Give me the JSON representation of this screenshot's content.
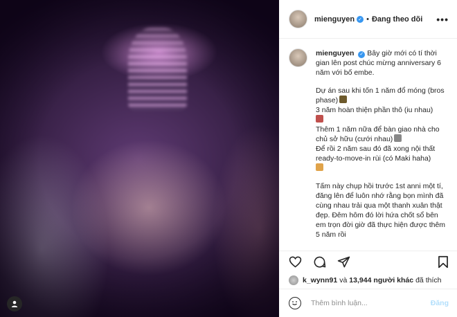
{
  "header": {
    "username": "mienguyen",
    "separator": "•",
    "follow_label": "Đang theo dõi",
    "more_label": "•••"
  },
  "caption": {
    "username": "mienguyen",
    "p1": "Bây giờ mới có tí thời gian lên post chúc mừng anniversary 6 năm với bố embe.",
    "l1": "Dự án sau khi tốn 1 năm đổ móng (bros phase)",
    "l2": "3 năm hoàn thiện phần thô (iu nhau)",
    "l3": "Thêm 1 năm nữa để bàn giao nhà cho chủ sở hữu (cưới nhau)",
    "l4": "Để rồi 2 năm sau đó đã xong nội thất ready-to-move-in rùi (có Maki haha)",
    "p3": "Tấm này chụp hồi trước 1st anni một tí, đăng lên để luôn nhớ rằng bọn mình đã cùng nhau trải qua một thanh xuân thật đẹp. Đêm hôm đó lời hứa chốt sổ bên em trọn đời giờ đã thực hiện được thêm 5 năm rồi"
  },
  "likes": {
    "user": "k_wynn91",
    "and_label": "và",
    "count": "13,944",
    "others_label": "người khác",
    "liked_label": "đã thích"
  },
  "comment": {
    "placeholder": "Thêm bình luận...",
    "post_label": "Đăng"
  },
  "icons": {
    "like": "heart-icon",
    "comment": "comment-icon",
    "share": "share-icon",
    "save": "bookmark-icon",
    "emoji": "emoji-icon",
    "tag": "user-tag-icon"
  },
  "colors": {
    "verified": "#3897f0",
    "post_button_disabled": "#b2dffc",
    "text": "#262626",
    "muted": "#8e8e8e"
  }
}
